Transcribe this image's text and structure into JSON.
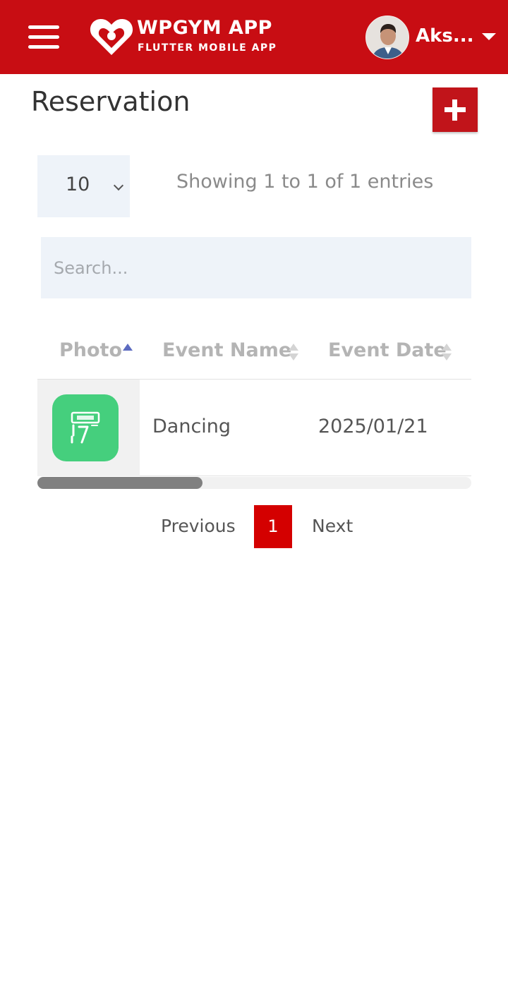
{
  "header": {
    "brand_title": "WPGYM APP",
    "brand_subtitle": "FLUTTER MOBILE APP",
    "user_name": "Aks...",
    "brand_color": "#c80d13"
  },
  "page": {
    "title": "Reservation"
  },
  "table_controls": {
    "entries_value": "10",
    "showing_text": "Showing 1 to 1 of 1 entries",
    "search_placeholder": "Search..."
  },
  "table": {
    "columns": [
      "Photo",
      "Event Name",
      "Event Date"
    ],
    "sorted_column": "Photo",
    "rows": [
      {
        "photo_icon": "event-book-icon",
        "event_name": "Dancing",
        "event_date": "2025/01/21"
      }
    ]
  },
  "pagination": {
    "previous_label": "Previous",
    "current_page": "1",
    "next_label": "Next",
    "active_color": "#d40000"
  }
}
